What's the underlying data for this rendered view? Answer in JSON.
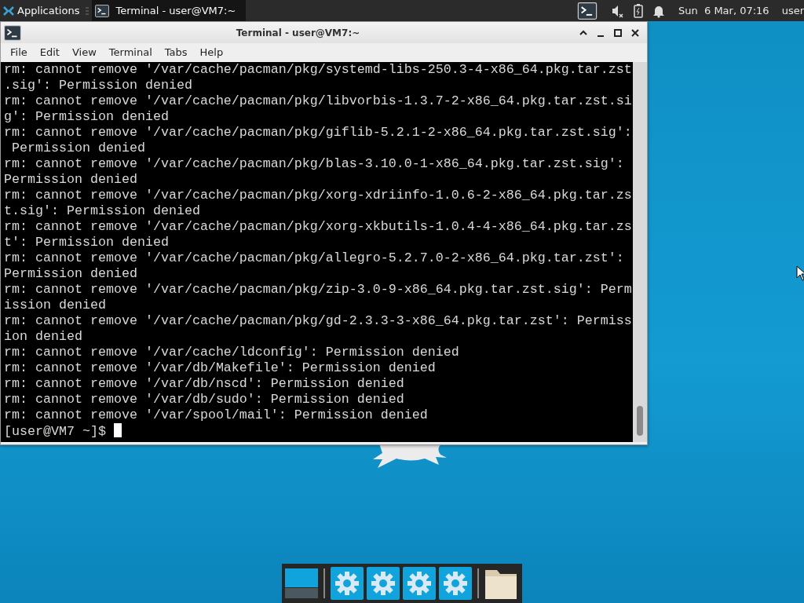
{
  "panel": {
    "applications": "Applications",
    "task": {
      "title": "Terminal - user@VM7:~",
      "selected": true
    },
    "clock": "Sun  6 Mar, 07:16",
    "user": "user"
  },
  "window": {
    "title": "Terminal - user@VM7:~"
  },
  "menu": [
    "File",
    "Edit",
    "View",
    "Terminal",
    "Tabs",
    "Help"
  ],
  "terminal": {
    "lines": [
      "rm: cannot remove '/var/cache/pacman/pkg/systemd-libs-250.3-4-x86_64.pkg.tar.zst",
      ".sig': Permission denied",
      "rm: cannot remove '/var/cache/pacman/pkg/libvorbis-1.3.7-2-x86_64.pkg.tar.zst.si",
      "g': Permission denied",
      "rm: cannot remove '/var/cache/pacman/pkg/giflib-5.2.1-2-x86_64.pkg.tar.zst.sig':",
      " Permission denied",
      "rm: cannot remove '/var/cache/pacman/pkg/blas-3.10.0-1-x86_64.pkg.tar.zst.sig':",
      "Permission denied",
      "rm: cannot remove '/var/cache/pacman/pkg/xorg-xdriinfo-1.0.6-2-x86_64.pkg.tar.zs",
      "t.sig': Permission denied",
      "rm: cannot remove '/var/cache/pacman/pkg/xorg-xkbutils-1.0.4-4-x86_64.pkg.tar.zs",
      "t': Permission denied",
      "rm: cannot remove '/var/cache/pacman/pkg/allegro-5.2.7.0-2-x86_64.pkg.tar.zst':",
      "Permission denied",
      "rm: cannot remove '/var/cache/pacman/pkg/zip-3.0-9-x86_64.pkg.tar.zst.sig': Perm",
      "ission denied",
      "rm: cannot remove '/var/cache/pacman/pkg/gd-2.3.3-3-x86_64.pkg.tar.zst': Permiss",
      "ion denied",
      "rm: cannot remove '/var/cache/ldconfig': Permission denied",
      "rm: cannot remove '/var/db/Makefile': Permission denied",
      "rm: cannot remove '/var/db/nscd': Permission denied",
      "rm: cannot remove '/var/db/sudo': Permission denied",
      "rm: cannot remove '/var/spool/mail': Permission denied"
    ],
    "prompt": "[user@VM7 ~]$ "
  },
  "dock": [
    {
      "kind": "desktop"
    },
    {
      "kind": "settings"
    },
    {
      "kind": "settings"
    },
    {
      "kind": "settings"
    },
    {
      "kind": "settings"
    },
    {
      "kind": "folder"
    }
  ]
}
